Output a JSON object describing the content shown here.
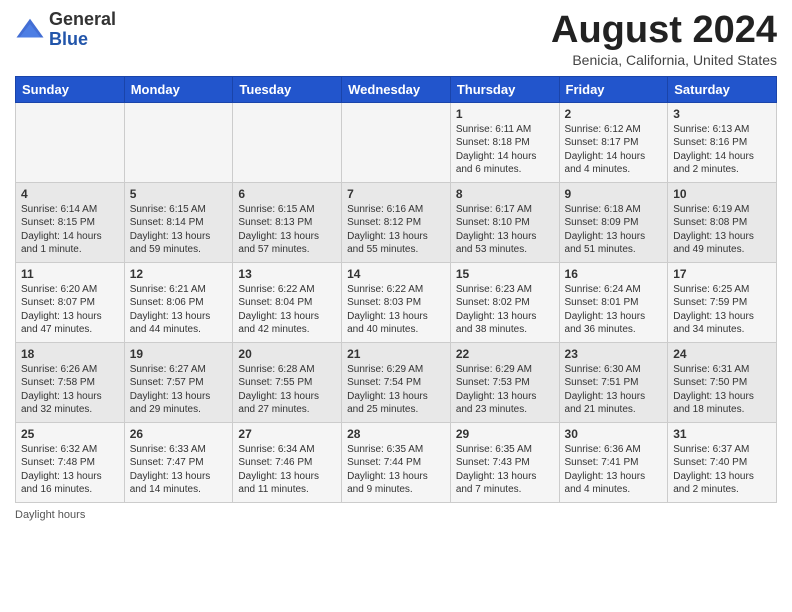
{
  "logo": {
    "general": "General",
    "blue": "Blue"
  },
  "title": "August 2024",
  "location": "Benicia, California, United States",
  "days_of_week": [
    "Sunday",
    "Monday",
    "Tuesday",
    "Wednesday",
    "Thursday",
    "Friday",
    "Saturday"
  ],
  "footer": {
    "daylight_label": "Daylight hours"
  },
  "weeks": [
    [
      {
        "day": "",
        "content": ""
      },
      {
        "day": "",
        "content": ""
      },
      {
        "day": "",
        "content": ""
      },
      {
        "day": "",
        "content": ""
      },
      {
        "day": "1",
        "content": "Sunrise: 6:11 AM\nSunset: 8:18 PM\nDaylight: 14 hours and 6 minutes."
      },
      {
        "day": "2",
        "content": "Sunrise: 6:12 AM\nSunset: 8:17 PM\nDaylight: 14 hours and 4 minutes."
      },
      {
        "day": "3",
        "content": "Sunrise: 6:13 AM\nSunset: 8:16 PM\nDaylight: 14 hours and 2 minutes."
      }
    ],
    [
      {
        "day": "4",
        "content": "Sunrise: 6:14 AM\nSunset: 8:15 PM\nDaylight: 14 hours and 1 minute."
      },
      {
        "day": "5",
        "content": "Sunrise: 6:15 AM\nSunset: 8:14 PM\nDaylight: 13 hours and 59 minutes."
      },
      {
        "day": "6",
        "content": "Sunrise: 6:15 AM\nSunset: 8:13 PM\nDaylight: 13 hours and 57 minutes."
      },
      {
        "day": "7",
        "content": "Sunrise: 6:16 AM\nSunset: 8:12 PM\nDaylight: 13 hours and 55 minutes."
      },
      {
        "day": "8",
        "content": "Sunrise: 6:17 AM\nSunset: 8:10 PM\nDaylight: 13 hours and 53 minutes."
      },
      {
        "day": "9",
        "content": "Sunrise: 6:18 AM\nSunset: 8:09 PM\nDaylight: 13 hours and 51 minutes."
      },
      {
        "day": "10",
        "content": "Sunrise: 6:19 AM\nSunset: 8:08 PM\nDaylight: 13 hours and 49 minutes."
      }
    ],
    [
      {
        "day": "11",
        "content": "Sunrise: 6:20 AM\nSunset: 8:07 PM\nDaylight: 13 hours and 47 minutes."
      },
      {
        "day": "12",
        "content": "Sunrise: 6:21 AM\nSunset: 8:06 PM\nDaylight: 13 hours and 44 minutes."
      },
      {
        "day": "13",
        "content": "Sunrise: 6:22 AM\nSunset: 8:04 PM\nDaylight: 13 hours and 42 minutes."
      },
      {
        "day": "14",
        "content": "Sunrise: 6:22 AM\nSunset: 8:03 PM\nDaylight: 13 hours and 40 minutes."
      },
      {
        "day": "15",
        "content": "Sunrise: 6:23 AM\nSunset: 8:02 PM\nDaylight: 13 hours and 38 minutes."
      },
      {
        "day": "16",
        "content": "Sunrise: 6:24 AM\nSunset: 8:01 PM\nDaylight: 13 hours and 36 minutes."
      },
      {
        "day": "17",
        "content": "Sunrise: 6:25 AM\nSunset: 7:59 PM\nDaylight: 13 hours and 34 minutes."
      }
    ],
    [
      {
        "day": "18",
        "content": "Sunrise: 6:26 AM\nSunset: 7:58 PM\nDaylight: 13 hours and 32 minutes."
      },
      {
        "day": "19",
        "content": "Sunrise: 6:27 AM\nSunset: 7:57 PM\nDaylight: 13 hours and 29 minutes."
      },
      {
        "day": "20",
        "content": "Sunrise: 6:28 AM\nSunset: 7:55 PM\nDaylight: 13 hours and 27 minutes."
      },
      {
        "day": "21",
        "content": "Sunrise: 6:29 AM\nSunset: 7:54 PM\nDaylight: 13 hours and 25 minutes."
      },
      {
        "day": "22",
        "content": "Sunrise: 6:29 AM\nSunset: 7:53 PM\nDaylight: 13 hours and 23 minutes."
      },
      {
        "day": "23",
        "content": "Sunrise: 6:30 AM\nSunset: 7:51 PM\nDaylight: 13 hours and 21 minutes."
      },
      {
        "day": "24",
        "content": "Sunrise: 6:31 AM\nSunset: 7:50 PM\nDaylight: 13 hours and 18 minutes."
      }
    ],
    [
      {
        "day": "25",
        "content": "Sunrise: 6:32 AM\nSunset: 7:48 PM\nDaylight: 13 hours and 16 minutes."
      },
      {
        "day": "26",
        "content": "Sunrise: 6:33 AM\nSunset: 7:47 PM\nDaylight: 13 hours and 14 minutes."
      },
      {
        "day": "27",
        "content": "Sunrise: 6:34 AM\nSunset: 7:46 PM\nDaylight: 13 hours and 11 minutes."
      },
      {
        "day": "28",
        "content": "Sunrise: 6:35 AM\nSunset: 7:44 PM\nDaylight: 13 hours and 9 minutes."
      },
      {
        "day": "29",
        "content": "Sunrise: 6:35 AM\nSunset: 7:43 PM\nDaylight: 13 hours and 7 minutes."
      },
      {
        "day": "30",
        "content": "Sunrise: 6:36 AM\nSunset: 7:41 PM\nDaylight: 13 hours and 4 minutes."
      },
      {
        "day": "31",
        "content": "Sunrise: 6:37 AM\nSunset: 7:40 PM\nDaylight: 13 hours and 2 minutes."
      }
    ]
  ]
}
